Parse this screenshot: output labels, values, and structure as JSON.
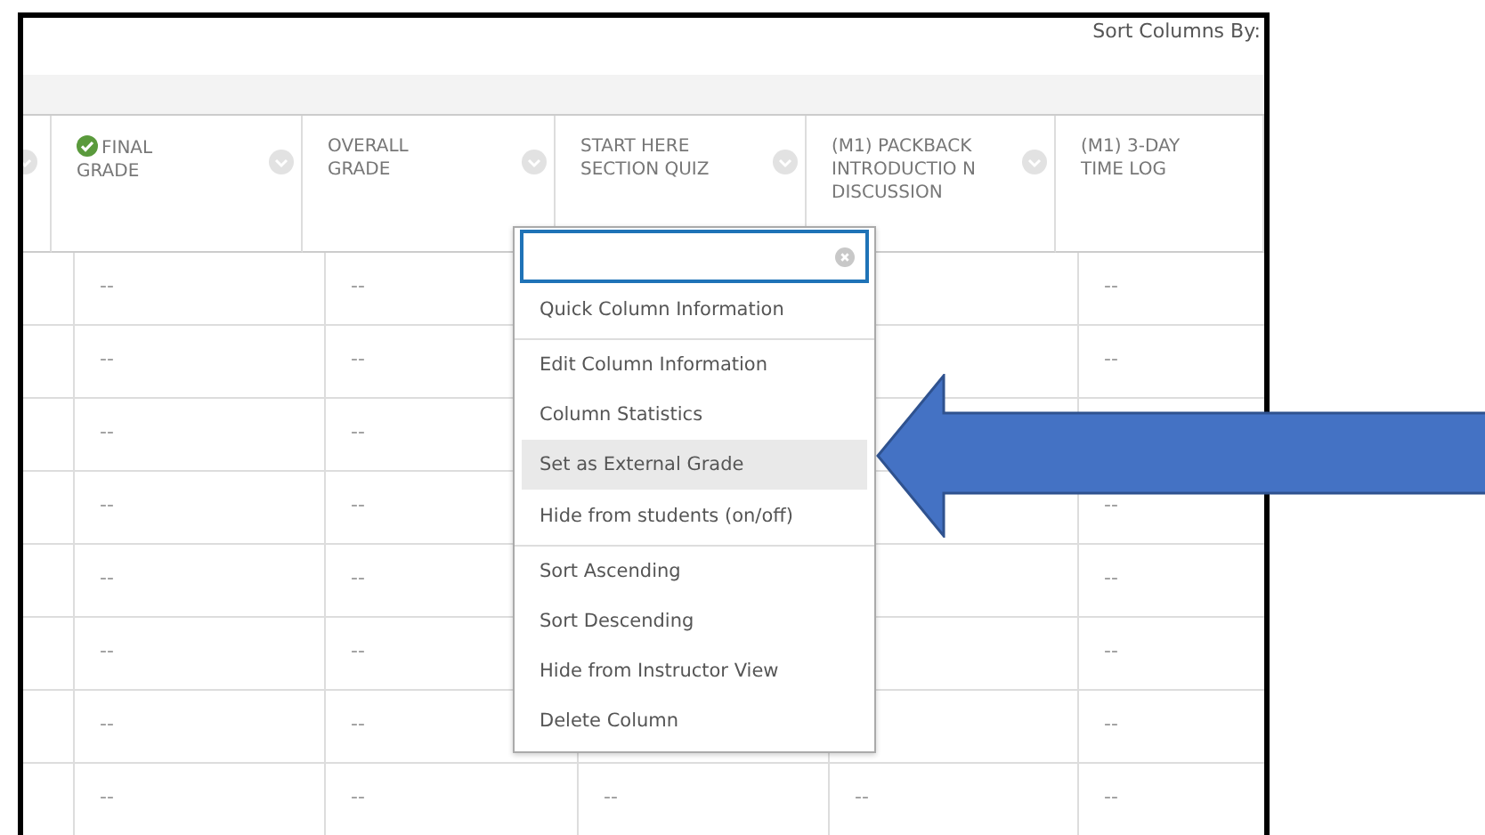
{
  "toolbar": {
    "sort_label": "Sort Columns By:"
  },
  "columns": [
    {
      "completed": false,
      "menu": true
    },
    {
      "label": "FINAL GRADE",
      "completed": true,
      "menu": true
    },
    {
      "label": "OVERALL GRADE",
      "completed": false,
      "menu": true
    },
    {
      "label": "START HERE SECTION QUIZ",
      "completed": false,
      "menu": true
    },
    {
      "label": "(M1) PACKBACK INTRODUCTIO N DISCUSSION",
      "completed": false,
      "menu": true
    },
    {
      "label": "(M1) 3-DAY TIME LOG",
      "completed": false,
      "menu": false
    }
  ],
  "rows": [
    [
      null,
      "--",
      "--",
      null,
      null,
      "--"
    ],
    [
      null,
      "--",
      "--",
      null,
      null,
      "--"
    ],
    [
      null,
      "--",
      "--",
      null,
      null,
      null
    ],
    [
      null,
      "--",
      "--",
      null,
      null,
      "--"
    ],
    [
      null,
      "--",
      "--",
      null,
      null,
      "--"
    ],
    [
      null,
      "--",
      "--",
      null,
      null,
      "--"
    ],
    [
      null,
      "--",
      "--",
      null,
      null,
      "--"
    ],
    [
      null,
      "--",
      "--",
      "--",
      "--",
      "--"
    ]
  ],
  "column_menu": {
    "items": [
      {
        "label": "Quick Column Information",
        "selected": false,
        "divider_after": true
      },
      {
        "label": "Edit Column Information",
        "selected": false,
        "divider_after": false
      },
      {
        "label": "Column Statistics",
        "selected": false,
        "divider_after": false
      },
      {
        "label": "Set as External Grade",
        "selected": true,
        "divider_after": false
      },
      {
        "label": "Hide from students (on/off)",
        "selected": false,
        "divider_after": true
      },
      {
        "label": "Sort Ascending",
        "selected": false,
        "divider_after": false
      },
      {
        "label": "Sort Descending",
        "selected": false,
        "divider_after": false
      },
      {
        "label": "Hide from Instructor View",
        "selected": false,
        "divider_after": false
      },
      {
        "label": "Delete Column",
        "selected": false,
        "divider_after": false
      }
    ]
  }
}
